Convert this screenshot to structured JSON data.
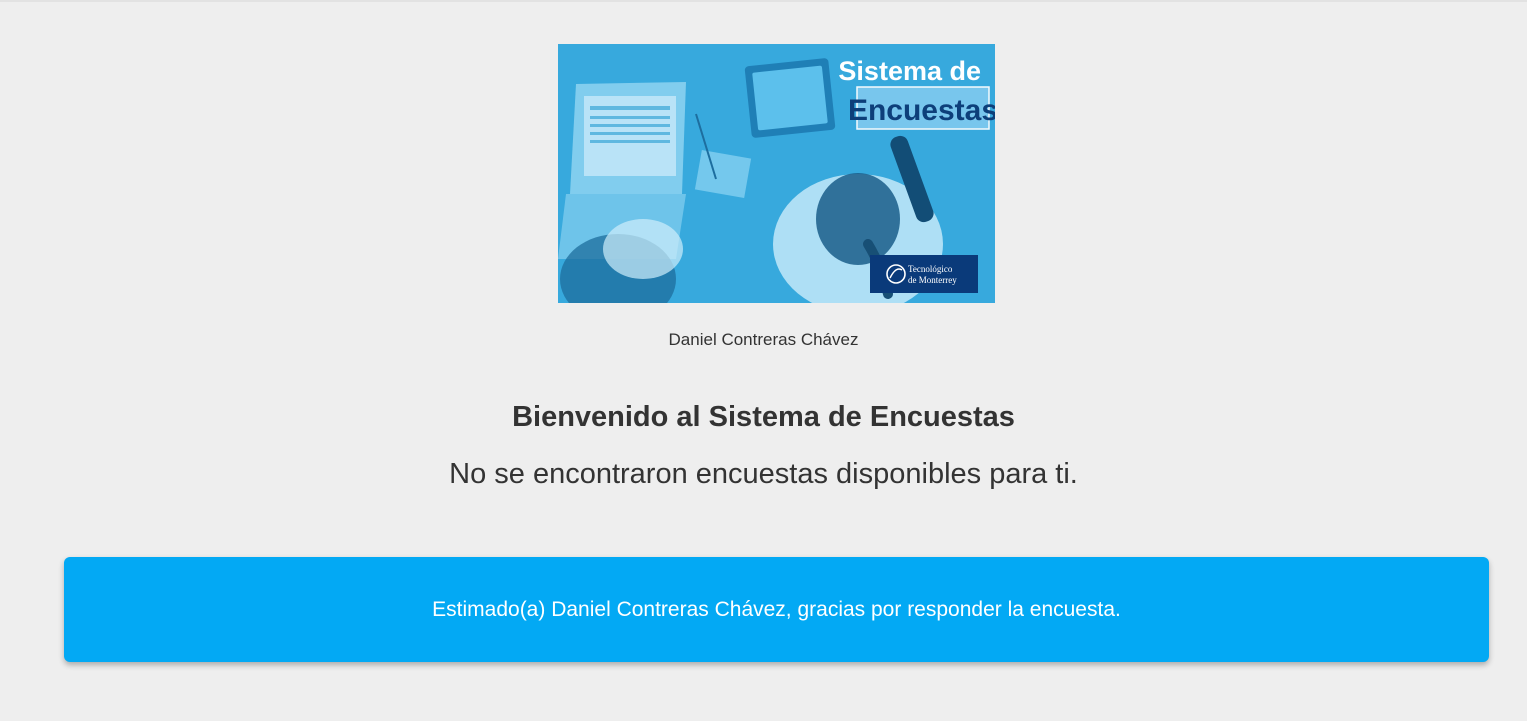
{
  "banner": {
    "title_line1": "Sistema de",
    "title_line2": "Encuestas",
    "logo_line1": "Tecnológico",
    "logo_line2": "de Monterrey"
  },
  "user": {
    "name": "Daniel Contreras Chávez"
  },
  "main": {
    "heading": "Bienvenido al Sistema de Encuestas",
    "empty_message": "No se encontraron encuestas disponibles para ti."
  },
  "notice": {
    "message": "Estimado(a) Daniel Contreras Chávez, gracias por responder la encuesta."
  },
  "colors": {
    "background": "#eeeeee",
    "accent": "#03a9f4",
    "banner_blue": "#2ea3db",
    "logo_navy": "#0a3a7a"
  }
}
